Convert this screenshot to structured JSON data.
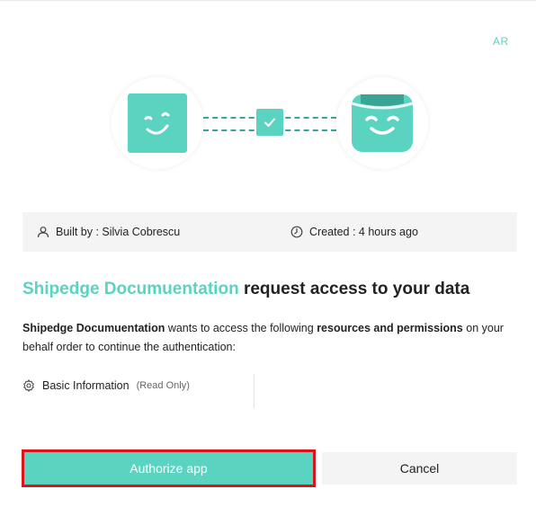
{
  "language_toggle": "AR",
  "connection": {
    "app_icon": "smiley-face-icon",
    "user_icon": "smiley-card-icon",
    "link_icon": "check-icon",
    "accent_color": "#5ad3c1",
    "accent_dark": "#3aa596"
  },
  "info": {
    "builder": "Built by : Silvia Cobrescu",
    "created": "Created : 4 hours ago"
  },
  "title": {
    "app_name": "Shipedge Documuentation",
    "rest": " request access to your data"
  },
  "description": {
    "app_name": "Shipedge Documuentation",
    "part1": " wants to access the following ",
    "bold": "resources and permissions",
    "part2": " on your behalf order to continue the authentication:"
  },
  "permissions": [
    {
      "label": "Basic Information",
      "note": "(Read Only)"
    }
  ],
  "actions": {
    "authorize": "Authorize app",
    "cancel": "Cancel",
    "highlight_color": "#d9141a"
  }
}
